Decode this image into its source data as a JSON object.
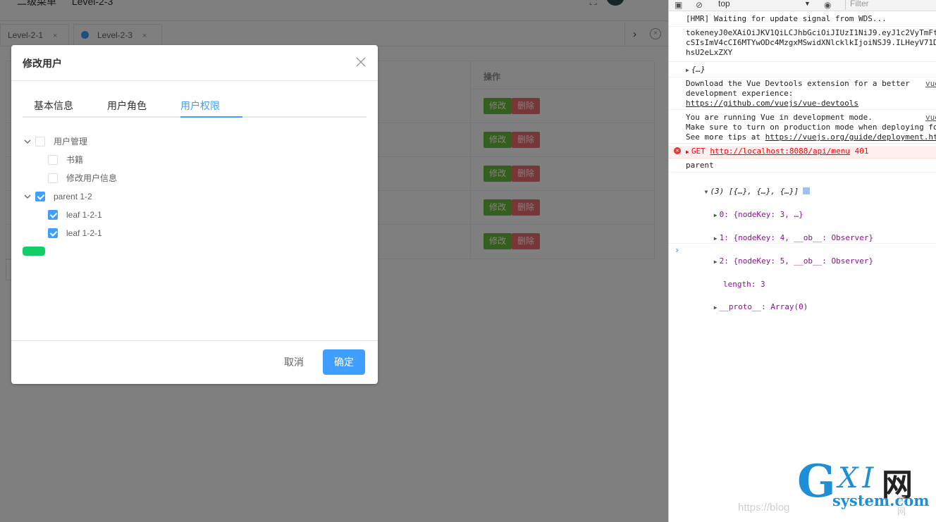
{
  "topbar": {
    "breadcrumb": [
      "二级菜单",
      "Level-2-3"
    ]
  },
  "tabs": [
    {
      "label": "Level-2-1",
      "close": "×"
    },
    {
      "label": "Level-2-3",
      "close": "×"
    }
  ],
  "table": {
    "op_header": "操作",
    "rows": [
      {
        "edit": "修改",
        "delete": "删除"
      },
      {
        "edit": "修改",
        "delete": "删除"
      },
      {
        "edit": "修改",
        "delete": "删除"
      },
      {
        "edit": "修改",
        "delete": "删除"
      },
      {
        "edit": "修改",
        "delete": "删除"
      }
    ]
  },
  "dialog": {
    "title": "修改用户",
    "tabs": [
      "基本信息",
      "用户角色",
      "用户权限"
    ],
    "active_tab": 2,
    "tree": [
      {
        "label": "用户管理",
        "checked": false,
        "level": 0,
        "expanded": true
      },
      {
        "label": "书籍",
        "checked": false,
        "level": 1
      },
      {
        "label": "修改用户信息",
        "checked": false,
        "level": 1
      },
      {
        "label": "parent 1-2",
        "checked": true,
        "level": 0,
        "expanded": true
      },
      {
        "label": "leaf 1-2-1",
        "checked": true,
        "level": 1
      },
      {
        "label": "leaf 1-2-1",
        "checked": true,
        "level": 1
      }
    ],
    "cancel": "取消",
    "confirm": "确定"
  },
  "devtools": {
    "context": "top",
    "filter_placeholder": "Filter",
    "messages": {
      "hmr": "[HMR] Waiting for update signal from WDS...",
      "token1": "tokeneyJ0eXAiOiJKV1QiLCJhbGciOiJIUzI1NiJ9.eyJ1c2VyTmFt",
      "token2": "cSIsImV4cCI6MTYwODc4MzgxMSwidXNlcklkIjoiNSJ9.ILHeyV71D",
      "token3": "hsU2eLxZXY",
      "obj": "{…}",
      "devtools1": "Download the Vue Devtools extension for a better",
      "devtools2": "development experience:",
      "devtools_link": "https://github.com/vuejs/vue-devtools",
      "devmode1": "You are running Vue in development mode.",
      "devmode2": "Make sure to turn on production mode when deploying fo",
      "devmode3a": "See more tips at ",
      "devmode3b": "https://vuejs.org/guide/deployment.ht",
      "src": "vue",
      "err_method": "GET ",
      "err_url": "http://localhost:8088/api/menu",
      "err_code": " 401",
      "parent": "parent",
      "arr_head": "(3) [{…}, {…}, {…}]",
      "item0": "0: {nodeKey: 3, …}",
      "item1": "1: {nodeKey: 4, __ob__: Observer}",
      "item2": "2: {nodeKey: 5, __ob__: Observer}",
      "length": "length: 3",
      "proto": "__proto__: Array(0)"
    }
  },
  "watermark": {
    "g": "G",
    "xi": "XI",
    "wang": "网",
    "domain": "system.com",
    "faint": "https://blog",
    "faint2": "文网"
  },
  "colors": {
    "primary": "#409eff",
    "success": "#67c23a",
    "danger": "#f56c6c",
    "tree_button": "#13ce66"
  }
}
